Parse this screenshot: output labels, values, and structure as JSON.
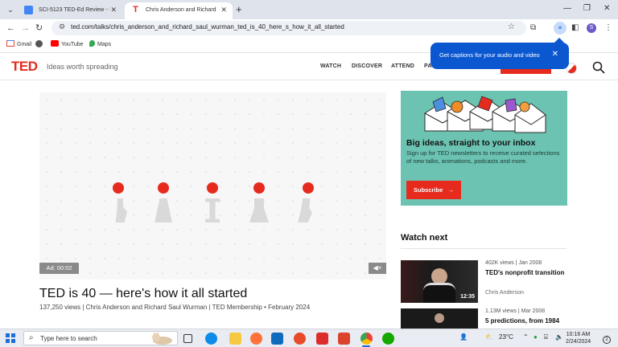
{
  "browser": {
    "tabs": [
      {
        "title": "SCI-5123 TED-Ed Review - Goo",
        "favicon": "google-docs-icon"
      },
      {
        "title": "Chris Anderson and Richard Sa",
        "favicon": "ted-icon"
      }
    ],
    "tab_favicon_ted": "T",
    "tab_close": "✕",
    "new_tab": "+",
    "window_controls": [
      "—",
      "❐",
      "✕"
    ],
    "url": "ted.com/talks/chris_anderson_and_richard_saul_wurman_ted_is_40_here_s_how_it_all_started",
    "bookmarks": [
      "Gmail",
      "",
      "YouTube",
      "Maps"
    ],
    "profile_initial": "S"
  },
  "captions_popover": {
    "text": "Get captions for your audio and video",
    "close": "✕"
  },
  "ted": {
    "logo": "TED",
    "tagline": "Ideas worth spreading",
    "nav": [
      "WATCH",
      "DISCOVER",
      "ATTEND",
      "PA"
    ],
    "brand_color": "#e62b1e"
  },
  "video": {
    "ad_label": "Ad: 00:02",
    "mute_icon": "speaker-muted-icon"
  },
  "talk": {
    "title": "TED is 40 — here's how it all started",
    "meta": "137,250 views | Chris Anderson and Richard Saul Wurman | TED Membership • February 2024"
  },
  "newsletter": {
    "heading": "Big ideas, straight to your inbox",
    "body": "Sign up for TED newsletters to receive curated selections of new talks, animations, podcasts and more.",
    "button": "Subscribe",
    "bg_color": "#6cc3b1"
  },
  "watch_next": {
    "heading": "Watch next",
    "items": [
      {
        "views": "402K views | Jan 2008",
        "title": "TED's nonprofit transition",
        "speaker": "Chris Anderson",
        "duration": "12:35"
      },
      {
        "views": "1.13M views | Mar 2008",
        "title": "5 predictions, from 1984",
        "speaker": "",
        "duration": ""
      }
    ]
  },
  "taskbar": {
    "search_placeholder": "Type here to search",
    "weather": "23°C",
    "time": "10:16 AM",
    "date": "2/24/2024",
    "notifications": "2"
  }
}
